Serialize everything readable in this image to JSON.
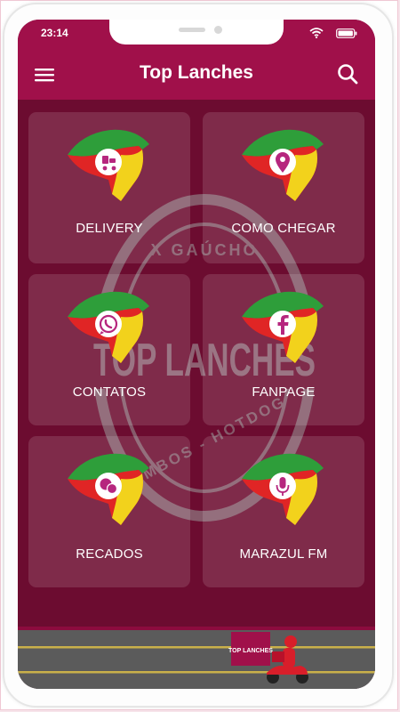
{
  "status_bar": {
    "time": "23:14"
  },
  "app_bar": {
    "title": "Top Lanches"
  },
  "watermark": {
    "top_text": "X GAÚCHO",
    "main_text": "TOP LANCHES",
    "bottom_text": "COMBOS - HOTDOG"
  },
  "tiles": [
    {
      "label": "DELIVERY",
      "icon": "delivery-icon"
    },
    {
      "label": "COMO CHEGAR",
      "icon": "location-pin-icon"
    },
    {
      "label": "CONTATOS",
      "icon": "whatsapp-icon"
    },
    {
      "label": "FANPAGE",
      "icon": "facebook-icon"
    },
    {
      "label": "RECADOS",
      "icon": "chat-bubbles-icon"
    },
    {
      "label": "MARAZUL FM",
      "icon": "microphone-icon"
    }
  ],
  "banner": {
    "logo_text": "TOP LANCHES"
  },
  "colors": {
    "primary": "#a0104a",
    "background": "#6c0c30",
    "tile": "rgba(255,255,255,0.13)",
    "text": "#ffffff"
  }
}
